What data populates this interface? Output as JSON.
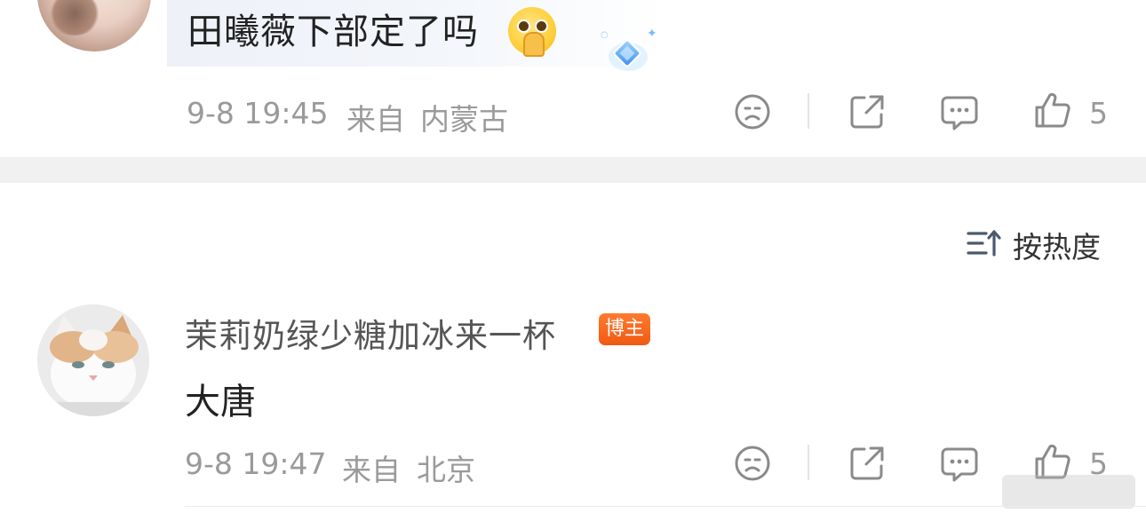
{
  "comment1": {
    "text": "田曦薇下部定了吗",
    "emoji": "pray-emoji",
    "decoration": "diamond-sticker-icon",
    "timestamp": "9-8 19:45",
    "from_label": "来自",
    "location": "内蒙古",
    "like_count": "5"
  },
  "sort": {
    "label": "按热度"
  },
  "comment2": {
    "username": "茉莉奶绿少糖加冰来一杯",
    "badge": "博主",
    "text": "大唐",
    "timestamp": "9-8 19:47",
    "from_label": "来自",
    "location": "北京",
    "like_count": "5"
  },
  "colors": {
    "meta_gray": "#9a9a9a",
    "badge_orange": "#f05a14",
    "divider": "#f1f1f1"
  }
}
